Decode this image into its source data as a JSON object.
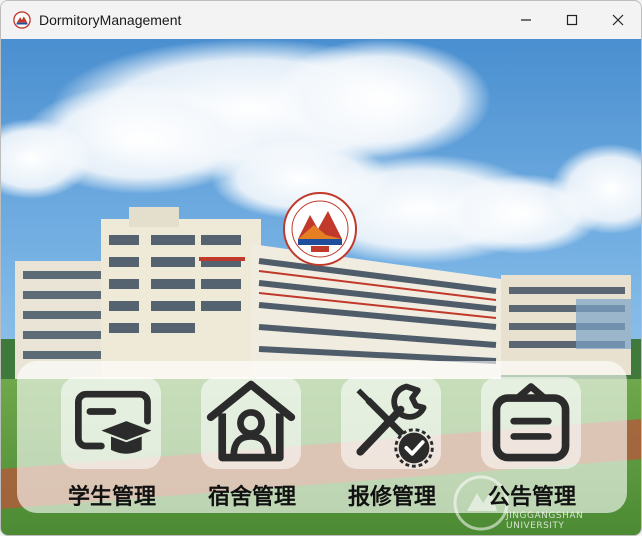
{
  "window": {
    "title": "DormitoryManagement"
  },
  "menu": [
    {
      "label": "学生管理",
      "icon": "student-cap-icon"
    },
    {
      "label": "宿舍管理",
      "icon": "house-person-icon"
    },
    {
      "label": "报修管理",
      "icon": "repair-tools-icon"
    },
    {
      "label": "公告管理",
      "icon": "notice-board-icon"
    }
  ],
  "watermark": "JINGGANGSHAN UNIVERSITY"
}
